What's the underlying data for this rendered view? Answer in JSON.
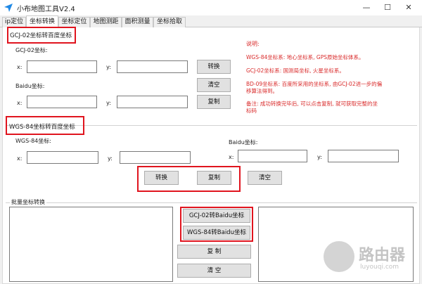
{
  "window": {
    "title": "小布地图工具V2.4",
    "minimize": "—",
    "maximize": "☐",
    "close": "✕"
  },
  "tabs": [
    {
      "label": "ip定位"
    },
    {
      "label": "坐标转换"
    },
    {
      "label": "坐标定位"
    },
    {
      "label": "地图测距"
    },
    {
      "label": "面积测量"
    },
    {
      "label": "坐标拾取"
    }
  ],
  "gcj_section": {
    "title": "GCJ-02坐标转百度坐标",
    "gcj_label": "GCJ-02坐标:",
    "x_label": "x:",
    "y_label": "y:",
    "x_value": "",
    "y_value": "",
    "convert_button": "转换",
    "baidu_label": "Baidu坐标:",
    "bx_label": "x:",
    "by_label": "y:",
    "bx_value": "",
    "by_value": "",
    "clear_button": "清空",
    "copy_button": "复制"
  },
  "notes": {
    "heading": "说明:",
    "lines": [
      "WGS-84坐标系: 地心坐标系, GPS原始坐标体系。",
      "GCJ-02坐标系: 国测局坐标, 火星坐标系。",
      "BD-09坐标系: 百度所采用的坐标系, 由GCJ-02进一步的偏",
      "移算法得到。",
      "备注: 成功转换完毕后, 可以点击复制, 就可获取完整的坐",
      "标码"
    ]
  },
  "wgs_section": {
    "title": "WGS-84坐标转百度坐标",
    "wgs_label": "WGS-84坐标:",
    "x_label": "x:",
    "y_label": "y:",
    "baidu_label": "Baidu坐标:",
    "bx_label": "x:",
    "by_label": "y:",
    "convert_button": "转换",
    "copy_button": "复制",
    "clear_button": "清空"
  },
  "batch_section": {
    "title": "批量坐标转换",
    "gcj_button": "GCJ-02转Baidu坐标",
    "wgs_button": "WGS-84转Baidu坐标",
    "copy_button": "复 制",
    "clear_button": "清 空"
  },
  "watermark": {
    "text": "路由器",
    "sub": "luyouqi.com"
  },
  "colors": {
    "accent_red": "#e0141e",
    "note_red": "#d92a2a",
    "title_icon": "#1e88e5"
  }
}
